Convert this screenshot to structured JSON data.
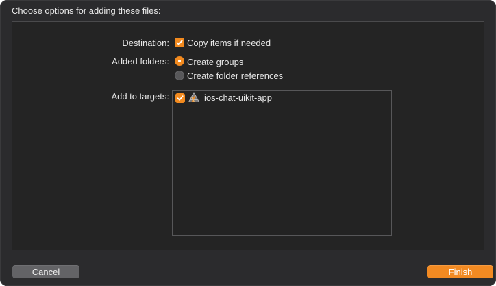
{
  "dialog": {
    "title": "Choose options for adding these files:"
  },
  "destination": {
    "label": "Destination:",
    "copy_items": {
      "label": "Copy items if needed",
      "checked": true
    }
  },
  "added_folders": {
    "label": "Added folders:",
    "options": [
      {
        "label": "Create groups",
        "selected": true
      },
      {
        "label": "Create folder references",
        "selected": false
      }
    ]
  },
  "targets": {
    "label": "Add to targets:",
    "items": [
      {
        "name": "ios-chat-uikit-app",
        "checked": true,
        "icon": "app-target-icon"
      }
    ]
  },
  "buttons": {
    "cancel": "Cancel",
    "finish": "Finish"
  },
  "colors": {
    "accent": "#f28a1f",
    "background": "#2b2b2d",
    "panel": "#242424"
  }
}
